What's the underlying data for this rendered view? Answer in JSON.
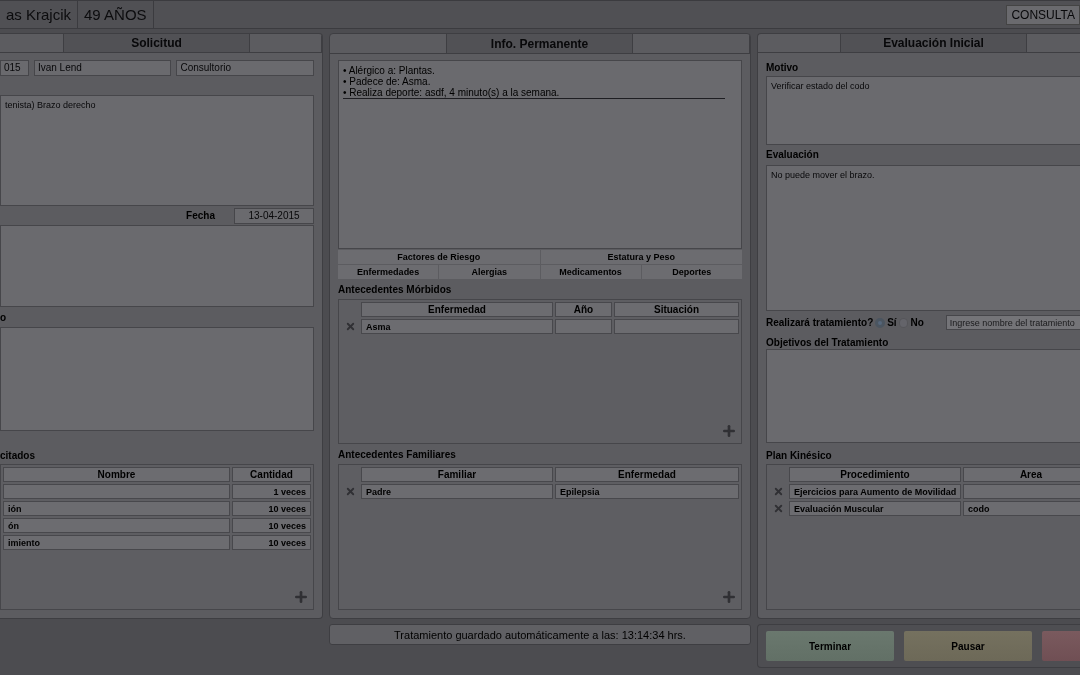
{
  "header": {
    "patient_name": "as Krajcik",
    "age": "49 AÑOS",
    "mode": "CONSULTA"
  },
  "solicitud": {
    "tab": "Solicitud",
    "fields": [
      "015",
      "Ivan Lend",
      "Consultorio"
    ],
    "description": "tenista) Brazo derecho",
    "fecha_label": "Fecha",
    "fecha": "13-04-2015",
    "section_label": "o",
    "table_title": "citados",
    "columns": [
      "Nombre",
      "Cantidad"
    ],
    "rows": [
      {
        "cantidad": "1 veces"
      },
      {
        "nombre": "ión",
        "cantidad": "10 veces"
      },
      {
        "nombre": "ón",
        "cantidad": "10 veces"
      },
      {
        "nombre": "imiento",
        "cantidad": "10 veces"
      }
    ]
  },
  "info": {
    "tab": "Info. Permanente",
    "summary": [
      "• Alérgico a: Plantas.",
      "• Padece de: Asma.",
      "• Realiza deporte: asdf, 4 minuto(s) a la semana."
    ],
    "button_rows": [
      [
        "Factores de Riesgo",
        "Estatura y Peso"
      ],
      [
        "Enfermedades",
        "Alergias",
        "Medicamentos",
        "Deportes"
      ]
    ],
    "morbidos": {
      "title": "Antecedentes Mórbidos",
      "columns": [
        "Enfermedad",
        "Año",
        "Situación"
      ],
      "rows": [
        [
          "Asma"
        ]
      ]
    },
    "familiares": {
      "title": "Antecedentes Familiares",
      "columns": [
        "Familiar",
        "Enfermedad"
      ],
      "rows": [
        [
          "Padre",
          "Epilepsia"
        ]
      ]
    }
  },
  "status": "Tratamiento guardado automáticamente a las: 13:14:34 hrs.",
  "evaluacion": {
    "tab": "Evaluación Inicial",
    "motivo_label": "Motivo",
    "motivo": "Verificar estado del codo",
    "evaluacion_label": "Evaluación",
    "evaluacion": "No puede mover el brazo.",
    "question": "Realizará tratamiento?",
    "options": [
      {
        "label": "Sí",
        "selected": true
      },
      {
        "label": "No",
        "selected": false
      }
    ],
    "treatment_placeholder": "Ingrese nombre del tratamiento",
    "objetivos_label": "Objetivos del Tratamiento",
    "plan": {
      "title": "Plan Kinésico",
      "columns": [
        "Procedimiento",
        "Area"
      ],
      "rows": [
        [
          "Ejercicios para Aumento de Movilidad"
        ],
        [
          "Evaluación Muscular",
          "codo"
        ]
      ]
    }
  },
  "actions": [
    {
      "label": "Terminar",
      "kind": "finish"
    },
    {
      "label": "Pausar",
      "kind": "pause"
    },
    {
      "kind": "cancel"
    }
  ]
}
